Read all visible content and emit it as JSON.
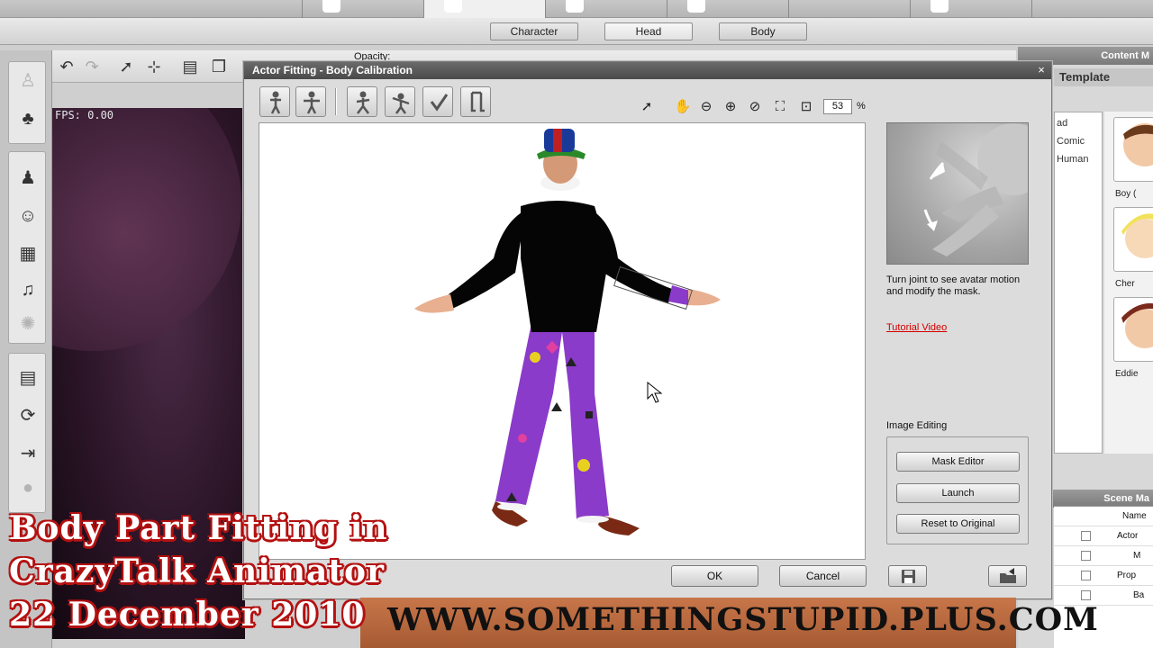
{
  "mode_tabs": {
    "character": "Character",
    "head": "Head",
    "body": "Body"
  },
  "toolbar": {
    "opacity_label": "Opacity:"
  },
  "stage": {
    "fps": "FPS: 0.00"
  },
  "dialog": {
    "title": "Actor Fitting - Body Calibration",
    "close": "×",
    "zoom_value": "53",
    "zoom_unit": "%",
    "hint": "Turn joint to see avatar motion and modify the mask.",
    "tutorial_link": "Tutorial Video",
    "image_editing_label": "Image Editing",
    "mask_editor": "Mask Editor",
    "launch": "Launch",
    "reset": "Reset to Original",
    "ok": "OK",
    "cancel": "Cancel"
  },
  "content_manager": {
    "header": "Content M",
    "template_label": "Template",
    "tree_items": [
      "ad",
      "Comic",
      "Human"
    ],
    "thumbnails": [
      "Boy (",
      "Cher",
      "Eddie"
    ]
  },
  "scene_manager": {
    "header": "Scene Ma",
    "name_col": "Name",
    "rows": [
      "Actor",
      "M",
      "Prop",
      "Ba"
    ]
  },
  "overlay": {
    "line1": "Body Part Fitting in",
    "line2": "CrazyTalk Animator",
    "line3": "22 December 2010",
    "url": "WWW.SOMETHINGSTUPID.PLUS.COM"
  },
  "colors": {
    "accent_red": "#d40000",
    "caption_outline": "#b41010",
    "pants_purple": "#8a3bc9"
  }
}
